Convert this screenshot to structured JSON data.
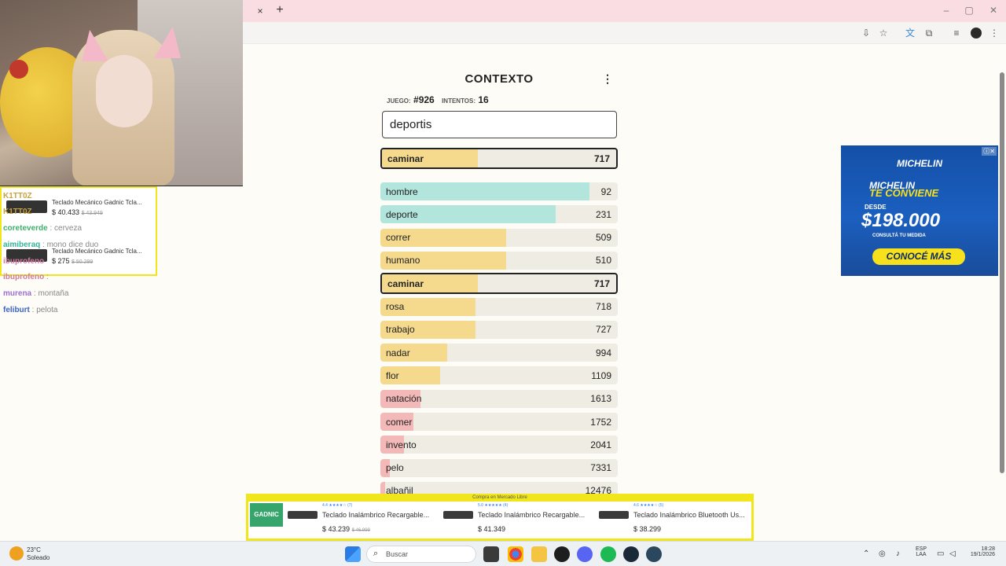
{
  "browser": {
    "tab_close_glyph": "×",
    "tab_new_glyph": "+",
    "window_controls": [
      "–",
      "▢",
      "✕"
    ]
  },
  "chat": {
    "ad_items": [
      {
        "title": "Teclado Mecánico Gadnic Tcla...",
        "price": "$ 40.433",
        "old_price": "$ 43.949"
      },
      {
        "title": "Teclado Mecánico Gadnic Tcla...",
        "price": "$ 275",
        "old_price": "$ 50.299"
      }
    ],
    "lines": [
      {
        "user": "K1TT0Z",
        "message": "",
        "color": "#c8a33c"
      },
      {
        "user": "K1TT0Z",
        "message": "",
        "color": "#c8a33c"
      },
      {
        "user": "coreteverde",
        "message": ": cerveza",
        "color": "#3cb06a"
      },
      {
        "user": "aimiberaq",
        "message": ": mono dice duo",
        "color": "#35b49a"
      },
      {
        "user": "ibuprofeno",
        "message": "",
        "color": "#d07aa0"
      },
      {
        "user": "ibuprofeno",
        "message": ":",
        "color": "#d07aa0"
      },
      {
        "user": "murena",
        "message": ": montaña",
        "color": "#9a6fd0"
      },
      {
        "user": "feliburt",
        "message": ": pelota",
        "color": "#3b63c9"
      }
    ]
  },
  "game": {
    "title": "CONTEXTO",
    "menu_glyph": "⋮",
    "game_label": "JUEGO:",
    "game_value": "#926",
    "attempts_label": "INTENTOS:",
    "attempts_value": "16",
    "input_value": "deportis",
    "current_guess": {
      "word": "caminar",
      "rank": "717"
    },
    "words": [
      {
        "word": "hombre",
        "rank": "92",
        "fill": 0.88,
        "color": "#b2e5dc"
      },
      {
        "word": "deporte",
        "rank": "231",
        "fill": 0.74,
        "color": "#b2e5dc"
      },
      {
        "word": "correr",
        "rank": "509",
        "fill": 0.53,
        "color": "#f5da8e"
      },
      {
        "word": "humano",
        "rank": "510",
        "fill": 0.53,
        "color": "#f5da8e"
      },
      {
        "word": "caminar",
        "rank": "717",
        "fill": 0.41,
        "color": "#f5da8e",
        "current": true
      },
      {
        "word": "rosa",
        "rank": "718",
        "fill": 0.4,
        "color": "#f5da8e"
      },
      {
        "word": "trabajo",
        "rank": "727",
        "fill": 0.4,
        "color": "#f5da8e"
      },
      {
        "word": "nadar",
        "rank": "994",
        "fill": 0.28,
        "color": "#f5da8e"
      },
      {
        "word": "flor",
        "rank": "1109",
        "fill": 0.25,
        "color": "#f5da8e"
      },
      {
        "word": "natación",
        "rank": "1613",
        "fill": 0.17,
        "color": "#f3b8b8"
      },
      {
        "word": "comer",
        "rank": "1752",
        "fill": 0.14,
        "color": "#f3b8b8"
      },
      {
        "word": "invento",
        "rank": "2041",
        "fill": 0.1,
        "color": "#f3b8b8"
      },
      {
        "word": "pelo",
        "rank": "7331",
        "fill": 0.04,
        "color": "#f3b8b8"
      },
      {
        "word": "albañil",
        "rank": "12476",
        "fill": 0.02,
        "color": "#f3b8b8"
      }
    ]
  },
  "ad_right": {
    "brand": "MICHELIN",
    "tagline_1": "MICHELIN",
    "tagline_2": "TE CONVIENE",
    "desde": "DESDE",
    "price": "$198.000",
    "sub": "CONSULTÁ TU MEDIDA",
    "cta": "CONOCÉ MÁS"
  },
  "ad_bottom": {
    "header": "Compra en Mercado Libre",
    "brand": "GADNIC",
    "products": [
      {
        "rating": "4.4 ★★★★☆ (7)",
        "title": "Teclado Inalámbrico Recargable...",
        "price": "$ 43.239",
        "old_price": "$ 46.999"
      },
      {
        "rating": "5.0 ★★★★★ (4)",
        "title": "Teclado Inalámbrico Recargable...",
        "price": "$ 41.349",
        "old_price": ""
      },
      {
        "rating": "4.6 ★★★★☆ (5)",
        "title": "Teclado Inalámbrico Bluetooth Us...",
        "price": "$ 38.299",
        "old_price": ""
      }
    ]
  },
  "taskbar": {
    "temperature": "23°C",
    "condition": "Soleado",
    "search_placeholder": "Buscar",
    "lang_1": "ESP",
    "lang_2": "LAA",
    "time": "18:28",
    "date": "19/1/2026"
  }
}
